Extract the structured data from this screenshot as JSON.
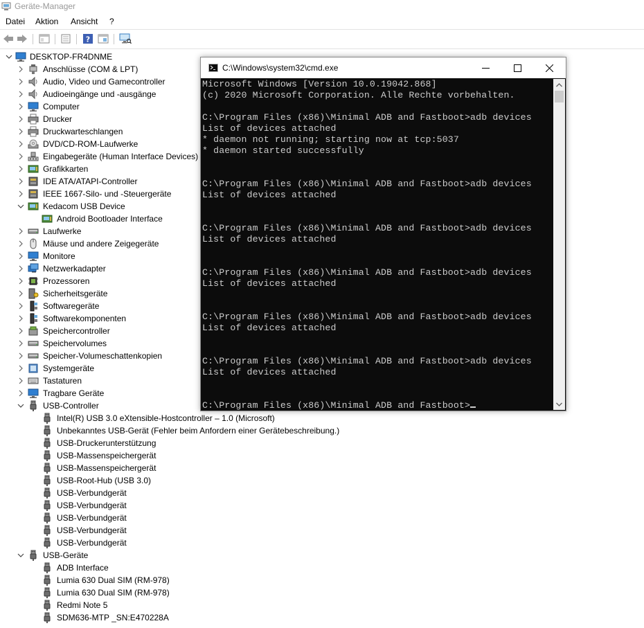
{
  "window": {
    "title": "Geräte-Manager",
    "icon": "device-manager-icon"
  },
  "menu": [
    "Datei",
    "Aktion",
    "Ansicht",
    "?"
  ],
  "toolbar": [
    "back-arrow-icon",
    "forward-arrow-icon",
    "properties-icon",
    "details-icon",
    "help-icon",
    "update-driver-icon",
    "scan-hardware-icon"
  ],
  "tree": {
    "root": "DESKTOP-FR4DNME",
    "items": [
      {
        "label": "Anschlüsse (COM & LPT)",
        "icon": "port-icon",
        "level": 1,
        "expanded": false
      },
      {
        "label": "Audio, Video und Gamecontroller",
        "icon": "speaker-icon",
        "level": 1,
        "expanded": false
      },
      {
        "label": "Audioeingänge und -ausgänge",
        "icon": "speaker-icon",
        "level": 1,
        "expanded": false
      },
      {
        "label": "Computer",
        "icon": "monitor-icon",
        "level": 1,
        "expanded": false
      },
      {
        "label": "Drucker",
        "icon": "printer-icon",
        "level": 1,
        "expanded": false
      },
      {
        "label": "Druckwarteschlangen",
        "icon": "printer-icon",
        "level": 1,
        "expanded": false
      },
      {
        "label": "DVD/CD-ROM-Laufwerke",
        "icon": "disc-icon",
        "level": 1,
        "expanded": false
      },
      {
        "label": "Eingabegeräte (Human Interface Devices)",
        "icon": "hid-icon",
        "level": 1,
        "expanded": false
      },
      {
        "label": "Grafikkarten",
        "icon": "display-adapter-icon",
        "level": 1,
        "expanded": false
      },
      {
        "label": "IDE ATA/ATAPI-Controller",
        "icon": "controller-icon",
        "level": 1,
        "expanded": false
      },
      {
        "label": "IEEE 1667-Silo- und -Steuergeräte",
        "icon": "controller-icon",
        "level": 1,
        "expanded": false
      },
      {
        "label": "Kedacom USB Device",
        "icon": "display-adapter-icon",
        "level": 1,
        "expanded": true
      },
      {
        "label": "Android Bootloader Interface",
        "icon": "display-adapter-icon",
        "level": 2
      },
      {
        "label": "Laufwerke",
        "icon": "drive-icon",
        "level": 1,
        "expanded": false
      },
      {
        "label": "Mäuse und andere Zeigegeräte",
        "icon": "mouse-icon",
        "level": 1,
        "expanded": false
      },
      {
        "label": "Monitore",
        "icon": "monitor-icon",
        "level": 1,
        "expanded": false
      },
      {
        "label": "Netzwerkadapter",
        "icon": "network-icon",
        "level": 1,
        "expanded": false
      },
      {
        "label": "Prozessoren",
        "icon": "processor-icon",
        "level": 1,
        "expanded": false
      },
      {
        "label": "Sicherheitsgeräte",
        "icon": "security-icon",
        "level": 1,
        "expanded": false
      },
      {
        "label": "Softwaregeräte",
        "icon": "software-icon",
        "level": 1,
        "expanded": false
      },
      {
        "label": "Softwarekomponenten",
        "icon": "software-icon",
        "level": 1,
        "expanded": false
      },
      {
        "label": "Speichercontroller",
        "icon": "storage-icon",
        "level": 1,
        "expanded": false
      },
      {
        "label": "Speichervolumes",
        "icon": "drive-icon",
        "level": 1,
        "expanded": false
      },
      {
        "label": "Speicher-Volumeschattenkopien",
        "icon": "drive-icon",
        "level": 1,
        "expanded": false
      },
      {
        "label": "Systemgeräte",
        "icon": "system-icon",
        "level": 1,
        "expanded": false
      },
      {
        "label": "Tastaturen",
        "icon": "keyboard-icon",
        "level": 1,
        "expanded": false
      },
      {
        "label": "Tragbare Geräte",
        "icon": "monitor-icon",
        "level": 1,
        "expanded": false
      },
      {
        "label": "USB-Controller",
        "icon": "usb-plug-icon",
        "level": 1,
        "expanded": true
      },
      {
        "label": "Intel(R) USB 3.0 eXtensible-Hostcontroller – 1.0 (Microsoft)",
        "icon": "usb-plug-icon",
        "level": 2
      },
      {
        "label": "Unbekanntes USB-Gerät (Fehler beim Anfordern einer Gerätebeschreibung.)",
        "icon": "usb-plug-icon",
        "level": 2
      },
      {
        "label": "USB-Druckerunterstützung",
        "icon": "usb-plug-icon",
        "level": 2
      },
      {
        "label": "USB-Massenspeichergerät",
        "icon": "usb-plug-icon",
        "level": 2
      },
      {
        "label": "USB-Massenspeichergerät",
        "icon": "usb-plug-icon",
        "level": 2
      },
      {
        "label": "USB-Root-Hub (USB 3.0)",
        "icon": "usb-plug-icon",
        "level": 2
      },
      {
        "label": "USB-Verbundgerät",
        "icon": "usb-plug-icon",
        "level": 2
      },
      {
        "label": "USB-Verbundgerät",
        "icon": "usb-plug-icon",
        "level": 2
      },
      {
        "label": "USB-Verbundgerät",
        "icon": "usb-plug-icon",
        "level": 2
      },
      {
        "label": "USB-Verbundgerät",
        "icon": "usb-plug-icon",
        "level": 2
      },
      {
        "label": "USB-Verbundgerät",
        "icon": "usb-plug-icon",
        "level": 2
      },
      {
        "label": "USB-Geräte",
        "icon": "usb-plug-icon",
        "level": 1,
        "expanded": true
      },
      {
        "label": "ADB Interface",
        "icon": "usb-plug-icon",
        "level": 2
      },
      {
        "label": "Lumia 630 Dual SIM (RM-978)",
        "icon": "usb-plug-icon",
        "level": 2
      },
      {
        "label": "Lumia 630 Dual SIM (RM-978)",
        "icon": "usb-plug-icon",
        "level": 2
      },
      {
        "label": "Redmi Note 5",
        "icon": "usb-plug-icon",
        "level": 2
      },
      {
        "label": "SDM636-MTP _SN:E470228A",
        "icon": "usb-plug-icon",
        "level": 2
      }
    ]
  },
  "cmd": {
    "title": "C:\\Windows\\system32\\cmd.exe",
    "output": "Microsoft Windows [Version 10.0.19042.868]\n(c) 2020 Microsoft Corporation. Alle Rechte vorbehalten.\n\nC:\\Program Files (x86)\\Minimal ADB and Fastboot>adb devices\nList of devices attached\n* daemon not running; starting now at tcp:5037\n* daemon started successfully\n\n\nC:\\Program Files (x86)\\Minimal ADB and Fastboot>adb devices\nList of devices attached\n\n\nC:\\Program Files (x86)\\Minimal ADB and Fastboot>adb devices\nList of devices attached\n\n\nC:\\Program Files (x86)\\Minimal ADB and Fastboot>adb devices\nList of devices attached\n\n\nC:\\Program Files (x86)\\Minimal ADB and Fastboot>adb devices\nList of devices attached\n\n\nC:\\Program Files (x86)\\Minimal ADB and Fastboot>adb devices\nList of devices attached\n\n\nC:\\Program Files (x86)\\Minimal ADB and Fastboot>"
  }
}
